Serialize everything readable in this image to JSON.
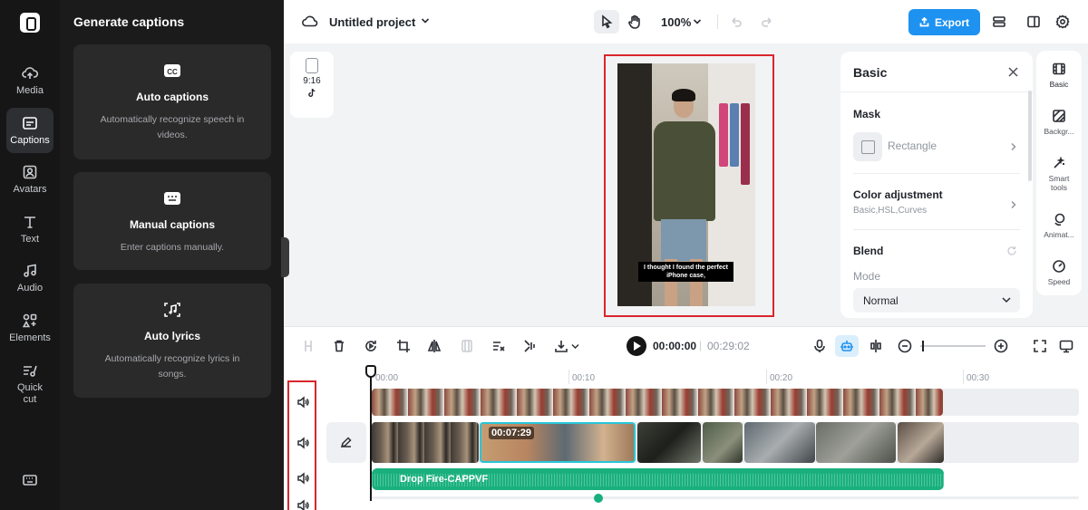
{
  "rail": {
    "items": [
      {
        "label": "Media",
        "icon": "cloud-upload-icon"
      },
      {
        "label": "Captions",
        "icon": "captions-icon",
        "active": true
      },
      {
        "label": "Avatars",
        "icon": "avatar-icon"
      },
      {
        "label": "Text",
        "icon": "text-icon"
      },
      {
        "label": "Audio",
        "icon": "music-note-icon"
      },
      {
        "label": "Elements",
        "icon": "elements-icon"
      },
      {
        "label": "Quick cut",
        "icon": "quick-cut-icon"
      }
    ]
  },
  "captions_panel": {
    "title": "Generate captions",
    "cards": [
      {
        "title": "Auto captions",
        "description": "Automatically recognize speech in videos.",
        "icon": "cc-icon"
      },
      {
        "title": "Manual captions",
        "description": "Enter captions manually.",
        "icon": "keyboard-icon"
      },
      {
        "title": "Auto lyrics",
        "description": "Automatically recognize lyrics in songs.",
        "icon": "lyrics-icon"
      }
    ]
  },
  "topbar": {
    "project_title": "Untitled project",
    "zoom": "100%",
    "export_label": "Export"
  },
  "canvas": {
    "aspect_ratio": "9:16",
    "platform_icon": "tiktok-icon",
    "caption_text": "I thought I found the perfect iPhone case,"
  },
  "props": {
    "title": "Basic",
    "mask": {
      "title": "Mask",
      "value": "Rectangle"
    },
    "color": {
      "title": "Color adjustment",
      "sub": "Basic,HSL,Curves"
    },
    "blend": {
      "title": "Blend",
      "mode_label": "Mode",
      "mode_value": "Normal"
    }
  },
  "mini_rail": {
    "items": [
      {
        "label": "Basic",
        "icon": "film-icon",
        "active": true
      },
      {
        "label": "Backgr...",
        "icon": "background-icon"
      },
      {
        "label": "Smart tools",
        "icon": "magic-wand-icon"
      },
      {
        "label": "Animat...",
        "icon": "animation-icon"
      },
      {
        "label": "Speed",
        "icon": "speed-icon"
      }
    ]
  },
  "timeline": {
    "current_time": "00:00:00",
    "separator": "|",
    "total_time": "00:29:02",
    "ruler": [
      "00:00",
      "00:10",
      "00:20",
      "00:30"
    ],
    "selected_clip_time": "00:07:29",
    "audio_label": "Drop Fire-CAPPVF"
  },
  "colors": {
    "accent": "#1e92f0",
    "selection": "#d8262d",
    "audio": "#19b07e",
    "clip_selected": "#28c6d9"
  }
}
